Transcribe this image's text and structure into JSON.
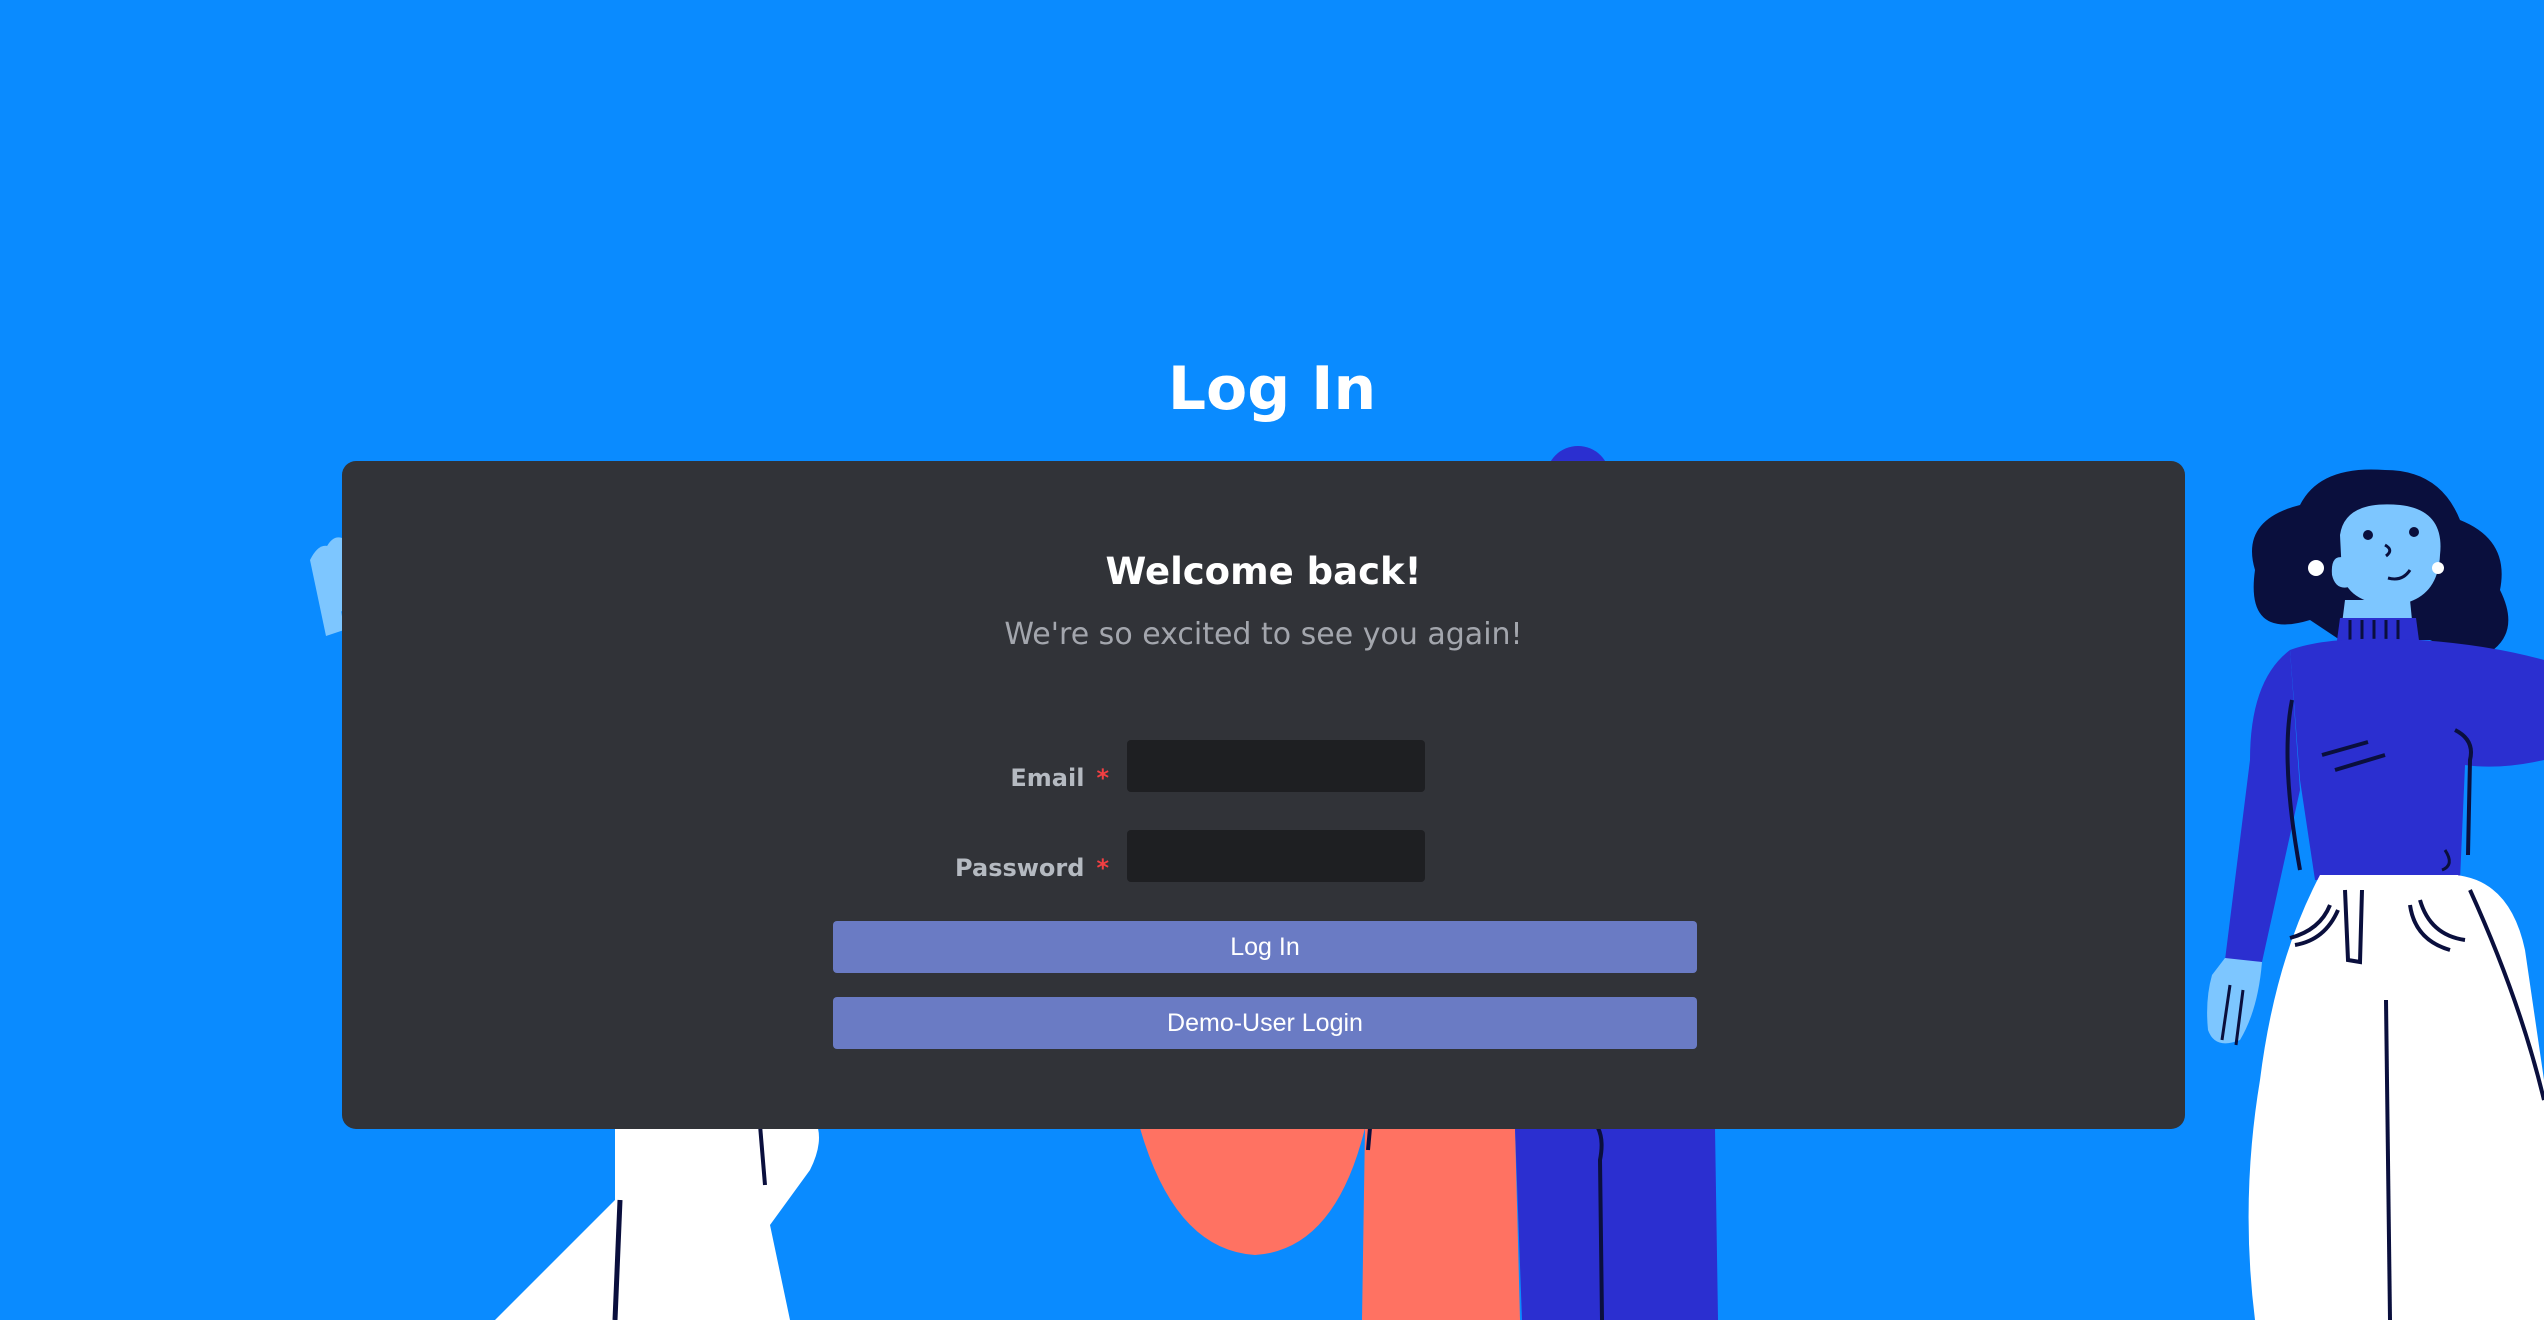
{
  "page": {
    "title": "Log In",
    "background_color": "#0a8bff"
  },
  "card": {
    "heading": "Welcome back!",
    "subheading": "We're so excited to see you again!",
    "background_color": "#313338"
  },
  "form": {
    "email": {
      "label": "Email",
      "required_marker": "*",
      "value": ""
    },
    "password": {
      "label": "Password",
      "required_marker": "*",
      "value": ""
    },
    "login_button_label": "Log In",
    "demo_button_label": "Demo-User Login",
    "button_color": "#6a7bc4",
    "required_color": "#f23f42"
  },
  "illustration": {
    "icon": "people-illustration",
    "colors": {
      "skin": "#7dc6ff",
      "hair": "#0a0f3d",
      "top": "#2b2fd0",
      "pants": "#ffffff",
      "coral": "#ff7262"
    }
  }
}
